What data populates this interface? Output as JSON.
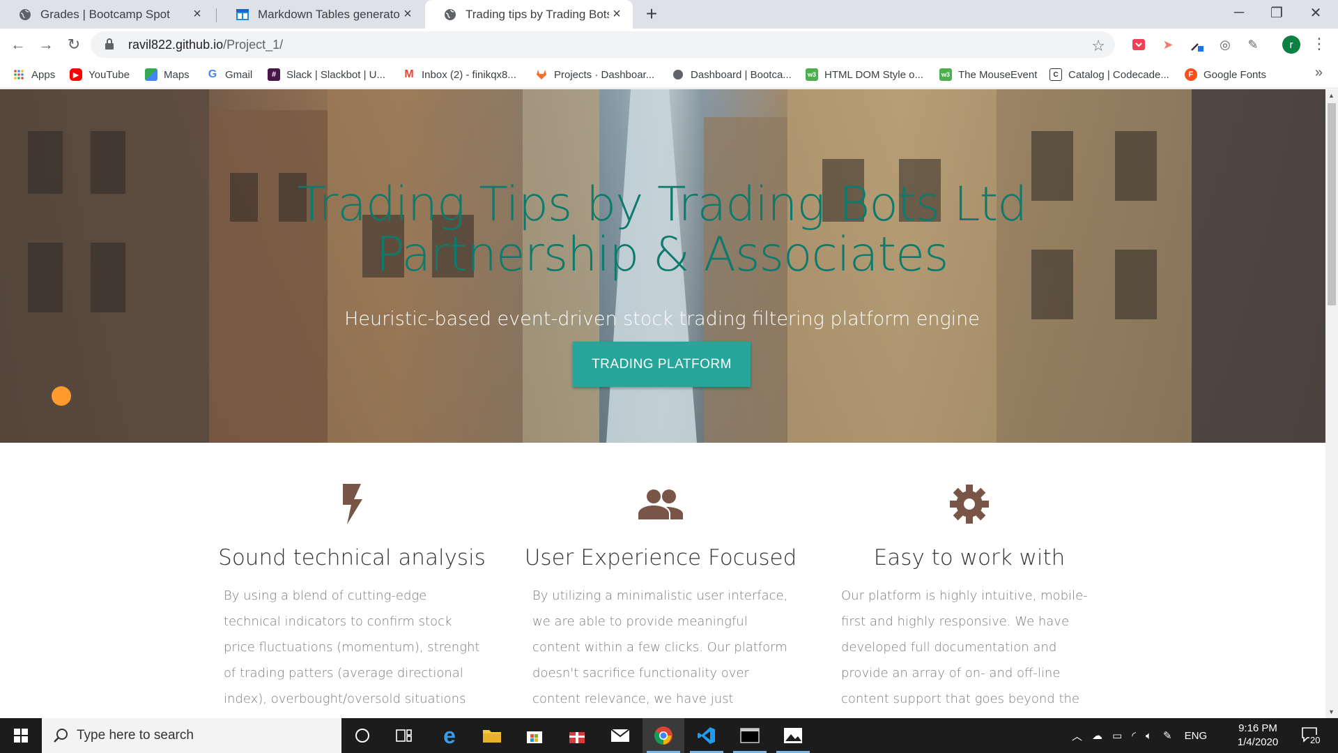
{
  "browser": {
    "tabs": [
      {
        "title": "Grades | Bootcamp Spot",
        "active": false
      },
      {
        "title": "Markdown Tables generator - Tab",
        "active": false
      },
      {
        "title": "Trading tips by Trading Bots Ltd I",
        "active": true
      }
    ],
    "address": {
      "host": "ravil822.github.io",
      "path": "/Project_1/"
    },
    "profile_initial": "r",
    "bookmarks": [
      {
        "label": "Apps",
        "icon": "apps-grid-icon"
      },
      {
        "label": "YouTube",
        "icon": "youtube-icon"
      },
      {
        "label": "Maps",
        "icon": "maps-icon"
      },
      {
        "label": "Gmail",
        "icon": "google-g-icon"
      },
      {
        "label": "Slack | Slackbot | U...",
        "icon": "slack-icon"
      },
      {
        "label": "Inbox (2) - finikqx8...",
        "icon": "gmail-icon"
      },
      {
        "label": "Projects · Dashboar...",
        "icon": "gitlab-icon"
      },
      {
        "label": "Dashboard | Bootca...",
        "icon": "globe-icon"
      },
      {
        "label": "HTML DOM Style o...",
        "icon": "w3schools-icon"
      },
      {
        "label": "The MouseEvent",
        "icon": "w3schools-icon"
      },
      {
        "label": "Catalog | Codecade...",
        "icon": "codecademy-icon"
      },
      {
        "label": "Google Fonts",
        "icon": "google-fonts-icon"
      }
    ]
  },
  "hero": {
    "title": "Trading Tips by Trading Bots Ltd Partnership & Associates",
    "subtitle": "Heuristic-based event-driven stock trading filtering platform engine",
    "cta": "TRADING PLATFORM"
  },
  "features": [
    {
      "icon": "flash-icon",
      "title": "Sound technical analysis",
      "text": "By using a blend of cutting-edge technical indicators to confirm stock price fluctuations (momentum), strenght of trading patters (average directional index), overbought/oversold situations (stochastic RSI),"
    },
    {
      "icon": "group-icon",
      "title": "User Experience Focused",
      "text": "By utilizing a minimalistic user interface, we are able to provide meaningful content within a few clicks. Our platform doesn't sacrifice functionality over content relevance, we have just eliminated non-value added content to"
    },
    {
      "icon": "settings-icon",
      "title": "Easy to work with",
      "text": "Our platform is highly intuitive, mobile-first and highly responsive. We have developed full documentation and provide an array of on- and off-line content support that goes beyond the use of our platform. By joining our community,"
    }
  ],
  "colors": {
    "accent": "#26a69a",
    "title": "#0c7a6c",
    "icon": "#795548"
  },
  "taskbar": {
    "search_placeholder": "Type here to search",
    "language": "ENG",
    "time": "9:16 PM",
    "date": "1/4/2020",
    "notification_count": "20"
  }
}
